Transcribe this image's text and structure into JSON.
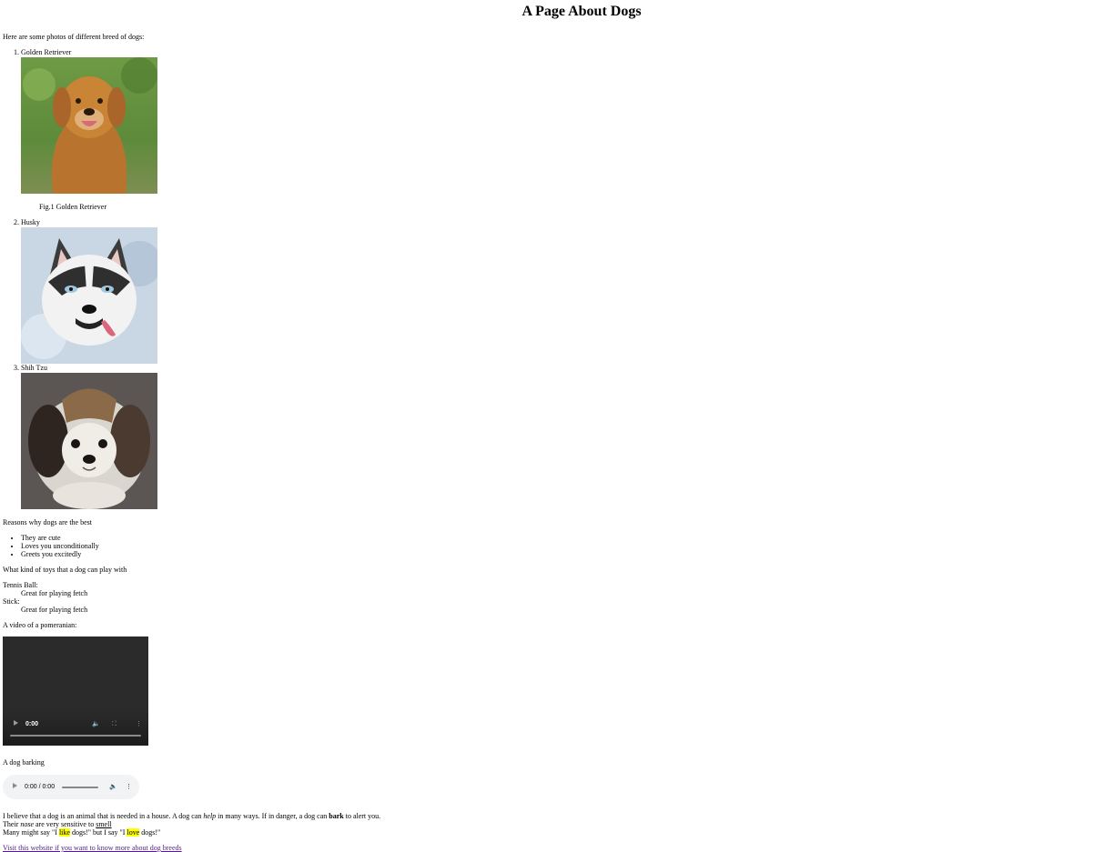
{
  "header": {
    "title": "A Page About Dogs"
  },
  "intro": "Here are some photos of different breed of dogs:",
  "breeds": [
    {
      "name": "Golden Retriever",
      "caption": "Fig.1 Golden Retriever"
    },
    {
      "name": "Husky"
    },
    {
      "name": "Shih Tzu"
    }
  ],
  "reasons": {
    "title": "Reasons why dogs are the best",
    "items": [
      "They are cute",
      "Loves you unconditionally",
      "Greets you excitedly"
    ]
  },
  "toys": {
    "title": "What kind of toys that a dog can play with",
    "items": [
      {
        "term": "Tennis Ball:",
        "desc": "Great for playing fetch"
      },
      {
        "term": "Stick:",
        "desc": "Great for playing fetch"
      }
    ]
  },
  "video": {
    "title": "A video of a pomeranian:",
    "time": "0:00"
  },
  "audio": {
    "title": "A dog barking",
    "time": "0:00 / 0:00"
  },
  "paragraph": {
    "line1_a": "I believe that a dog is an animal that is needed in a house. A dog can ",
    "line1_help": "help",
    "line1_b": " in many ways. If in danger, a dog can ",
    "line1_bark": "bark",
    "line1_c": " to alert you.",
    "line2_a": "Their ",
    "line2_nose": "nose",
    "line2_b": " are very sensitive to ",
    "line2_smell": "smell",
    "line3_a": "Many might say \"I ",
    "line3_like": "like",
    "line3_b": " dogs!\" but I say \"I ",
    "line3_love": "love",
    "line3_c": " dogs!\""
  },
  "link": {
    "text": "Visit this website if you want to know more about dog breeds"
  },
  "colors": {
    "link": "#551a8b",
    "highlight": "#ffff00",
    "video_bg": "#2b2b2b",
    "audio_bg": "#f1f3f4"
  }
}
